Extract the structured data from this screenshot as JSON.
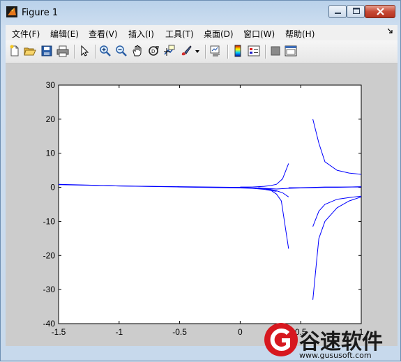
{
  "window": {
    "title": "Figure 1"
  },
  "menubar": {
    "items": [
      "文件(F)",
      "编辑(E)",
      "查看(V)",
      "插入(I)",
      "工具(T)",
      "桌面(D)",
      "窗口(W)",
      "帮助(H)"
    ]
  },
  "toolbar": {
    "icons": [
      "new-figure-icon",
      "open-file-icon",
      "save-icon",
      "print-icon",
      "select-arrow-icon",
      "zoom-in-icon",
      "zoom-out-icon",
      "pan-hand-icon",
      "rotate-3d-icon",
      "data-cursor-icon",
      "brush-icon",
      "brush-dropdown-icon",
      "link-plot-icon",
      "colorbar-icon",
      "legend-icon",
      "hide-plot-tools-icon",
      "show-plot-tools-icon"
    ]
  },
  "chart_data": {
    "type": "line",
    "title": "",
    "xlabel": "",
    "ylabel": "",
    "xlim": [
      -1.5,
      1
    ],
    "ylim": [
      -40,
      30
    ],
    "xticks": [
      "-1.5",
      "-1",
      "-0.5",
      "0",
      "0.5",
      "1"
    ],
    "yticks": [
      "30",
      "20",
      "10",
      "0",
      "-10",
      "-20",
      "-30",
      "-40"
    ],
    "grid": false,
    "line_color": "#0000ff",
    "series": [
      {
        "x": [
          -1.5,
          -1.25,
          -1.0,
          -0.75,
          -0.5,
          -0.25,
          0.0,
          0.1,
          0.2,
          0.3,
          0.4,
          0.5,
          0.6,
          0.7,
          0.8,
          0.9,
          1.0
        ],
        "y": [
          0.8,
          0.6,
          0.4,
          0.3,
          0.2,
          0.1,
          0.0,
          -0.2,
          -0.3,
          -0.5,
          -0.3,
          -0.2,
          -0.1,
          0.0,
          0.0,
          0.1,
          0.2
        ]
      },
      {
        "x": [
          -1.5,
          -1.0,
          -0.5,
          0.0,
          0.1,
          0.2,
          0.3
        ],
        "y": [
          0.9,
          0.4,
          0.1,
          -0.2,
          -0.3,
          -0.6,
          -1.2
        ]
      },
      {
        "x": [
          0.0,
          0.1,
          0.2,
          0.25,
          0.3,
          0.34,
          0.4
        ],
        "y": [
          -0.1,
          -0.2,
          -0.4,
          -0.8,
          -2.0,
          -4.0,
          -18.0
        ]
      },
      {
        "x": [
          0.0,
          0.1,
          0.2,
          0.25,
          0.3,
          0.35,
          0.4
        ],
        "y": [
          0.1,
          0.1,
          0.3,
          0.5,
          0.9,
          2.5,
          7.0
        ]
      },
      {
        "x": [
          0.15,
          0.2,
          0.25,
          0.3,
          0.35,
          0.4
        ],
        "y": [
          -0.1,
          -0.3,
          -0.6,
          -1.0,
          -1.6,
          -2.8
        ]
      },
      {
        "x": [
          0.6,
          0.65,
          0.7,
          0.8,
          0.9,
          1.0
        ],
        "y": [
          20.0,
          13.0,
          7.5,
          5.0,
          4.2,
          3.8
        ]
      },
      {
        "x": [
          0.6,
          0.63,
          0.65,
          0.7,
          0.8,
          0.9,
          1.0
        ],
        "y": [
          -33.0,
          -22.0,
          -15.0,
          -10.0,
          -6.0,
          -4.0,
          -2.8
        ]
      },
      {
        "x": [
          0.6,
          0.65,
          0.7,
          0.8,
          0.9,
          1.0
        ],
        "y": [
          -11.5,
          -7.0,
          -5.0,
          -3.5,
          -3.0,
          -2.6
        ]
      },
      {
        "x": [
          0.4,
          0.5,
          0.6,
          0.7,
          0.8,
          0.9,
          1.0
        ],
        "y": [
          -0.1,
          -0.1,
          0.0,
          0.1,
          0.1,
          0.1,
          0.1
        ]
      }
    ]
  },
  "watermark": {
    "name": "谷速软件",
    "url": "www.gususoft.com"
  }
}
